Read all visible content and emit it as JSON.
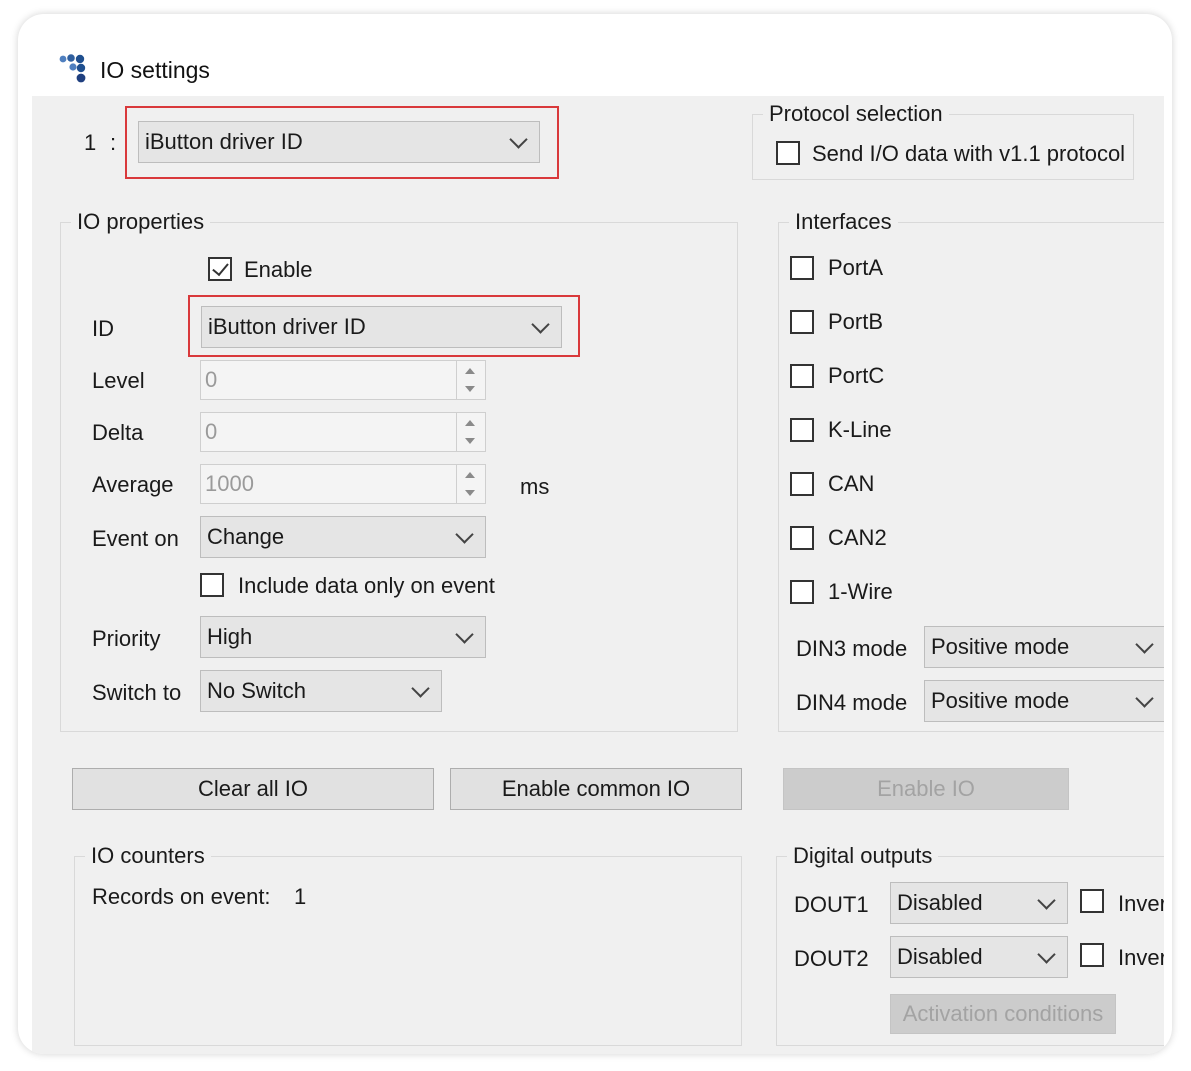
{
  "window": {
    "title": "IO settings"
  },
  "io_selector": {
    "index": "1",
    "separator": ":",
    "value": "iButton driver ID"
  },
  "protocol": {
    "title": "Protocol selection",
    "send_v11_label": "Send I/O data with v1.1 protocol",
    "send_v11_checked": false
  },
  "io_properties": {
    "title": "IO properties",
    "enable_label": "Enable",
    "enable_checked": true,
    "id_label": "ID",
    "id_value": "iButton driver ID",
    "level_label": "Level",
    "level_value": "0",
    "delta_label": "Delta",
    "delta_value": "0",
    "average_label": "Average",
    "average_value": "1000",
    "average_unit": "ms",
    "event_on_label": "Event on",
    "event_on_value": "Change",
    "include_label": "Include data only on event",
    "include_checked": false,
    "priority_label": "Priority",
    "priority_value": "High",
    "switch_to_label": "Switch to",
    "switch_to_value": "No Switch"
  },
  "interfaces": {
    "title": "Interfaces",
    "items": [
      {
        "label": "PortA",
        "checked": false
      },
      {
        "label": "PortB",
        "checked": false
      },
      {
        "label": "PortC",
        "checked": false
      },
      {
        "label": "K-Line",
        "checked": false
      },
      {
        "label": "CAN",
        "checked": false
      },
      {
        "label": "CAN2",
        "checked": false
      },
      {
        "label": "1-Wire",
        "checked": false
      }
    ],
    "din3_label": "DIN3 mode",
    "din3_value": "Positive mode",
    "din4_label": "DIN4 mode",
    "din4_value": "Positive mode"
  },
  "buttons": {
    "clear_all": "Clear all IO",
    "enable_common": "Enable common IO",
    "enable_io": "Enable IO"
  },
  "io_counters": {
    "title": "IO counters",
    "records_label": "Records on event:",
    "records_value": "1"
  },
  "digital_outputs": {
    "title": "Digital outputs",
    "dout1_label": "DOUT1",
    "dout1_value": "Disabled",
    "dout1_inverted_label": "Inverte",
    "dout2_label": "DOUT2",
    "dout2_value": "Disabled",
    "dout2_inverted_label": "Inverte",
    "activation_conditions": "Activation conditions"
  },
  "colors": {
    "highlight": "#d9393b",
    "client_bg": "#f0f0f0",
    "disabled_text": "#a3a3a3",
    "icon_blue": "#1f4f8f"
  }
}
